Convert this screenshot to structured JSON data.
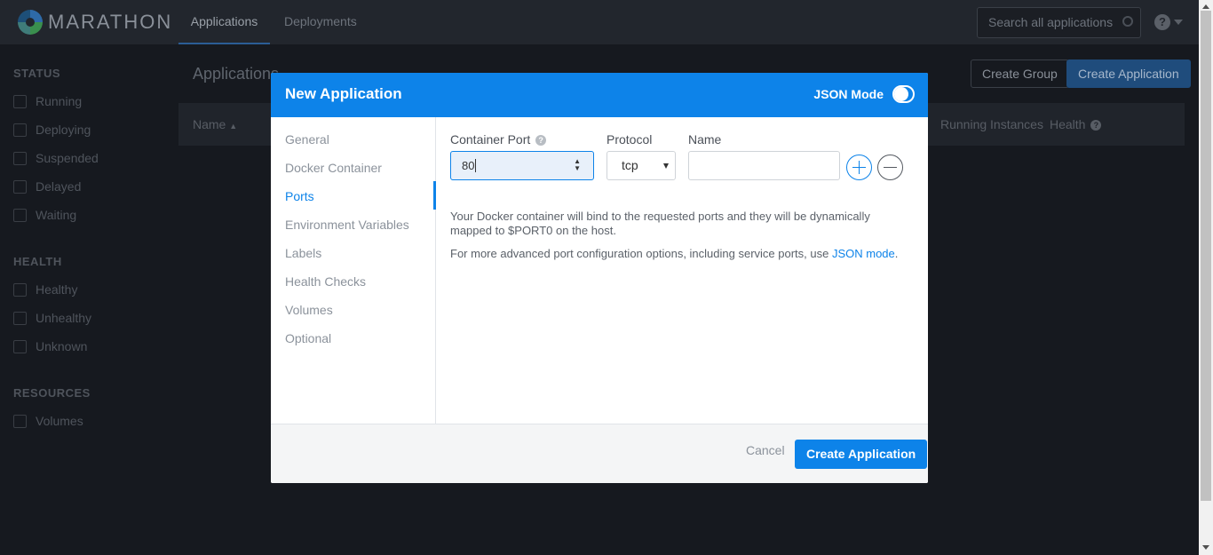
{
  "app": {
    "logo_text": "MARATHON"
  },
  "topnav": {
    "tabs": [
      {
        "label": "Applications",
        "active": true
      },
      {
        "label": "Deployments",
        "active": false
      }
    ]
  },
  "search": {
    "placeholder": "Search all applications"
  },
  "sidebar": {
    "status_heading": "STATUS",
    "status_items": [
      "Running",
      "Deploying",
      "Suspended",
      "Delayed",
      "Waiting"
    ],
    "health_heading": "HEALTH",
    "health_items": [
      "Healthy",
      "Unhealthy",
      "Unknown"
    ],
    "resources_heading": "RESOURCES",
    "resources_items": [
      "Volumes"
    ]
  },
  "main": {
    "title": "Applications",
    "create_group_label": "Create Group",
    "create_app_label": "Create Application",
    "columns": {
      "name": "Name",
      "running_instances": "Running Instances",
      "health": "Health"
    }
  },
  "modal": {
    "title": "New Application",
    "json_mode_label": "JSON Mode",
    "json_mode_on": false,
    "nav": [
      "General",
      "Docker Container",
      "Ports",
      "Environment Variables",
      "Labels",
      "Health Checks",
      "Volumes",
      "Optional"
    ],
    "active_nav": "Ports",
    "ports": {
      "container_port_label": "Container Port",
      "container_port_value": "80",
      "protocol_label": "Protocol",
      "protocol_value": "tcp",
      "name_label": "Name",
      "name_value": ""
    },
    "help_text_1": "Your Docker container will bind to the requested ports and they will be dynamically mapped to $PORT0 on the host.",
    "help_text_2_prefix": "For more advanced port configuration options, including service ports, use ",
    "help_text_2_link": "JSON mode",
    "help_text_2_suffix": ".",
    "cancel_label": "Cancel",
    "create_label": "Create Application"
  },
  "colors": {
    "accent": "#0d83e9",
    "topbar": "#22262d",
    "background": "#16191f"
  }
}
